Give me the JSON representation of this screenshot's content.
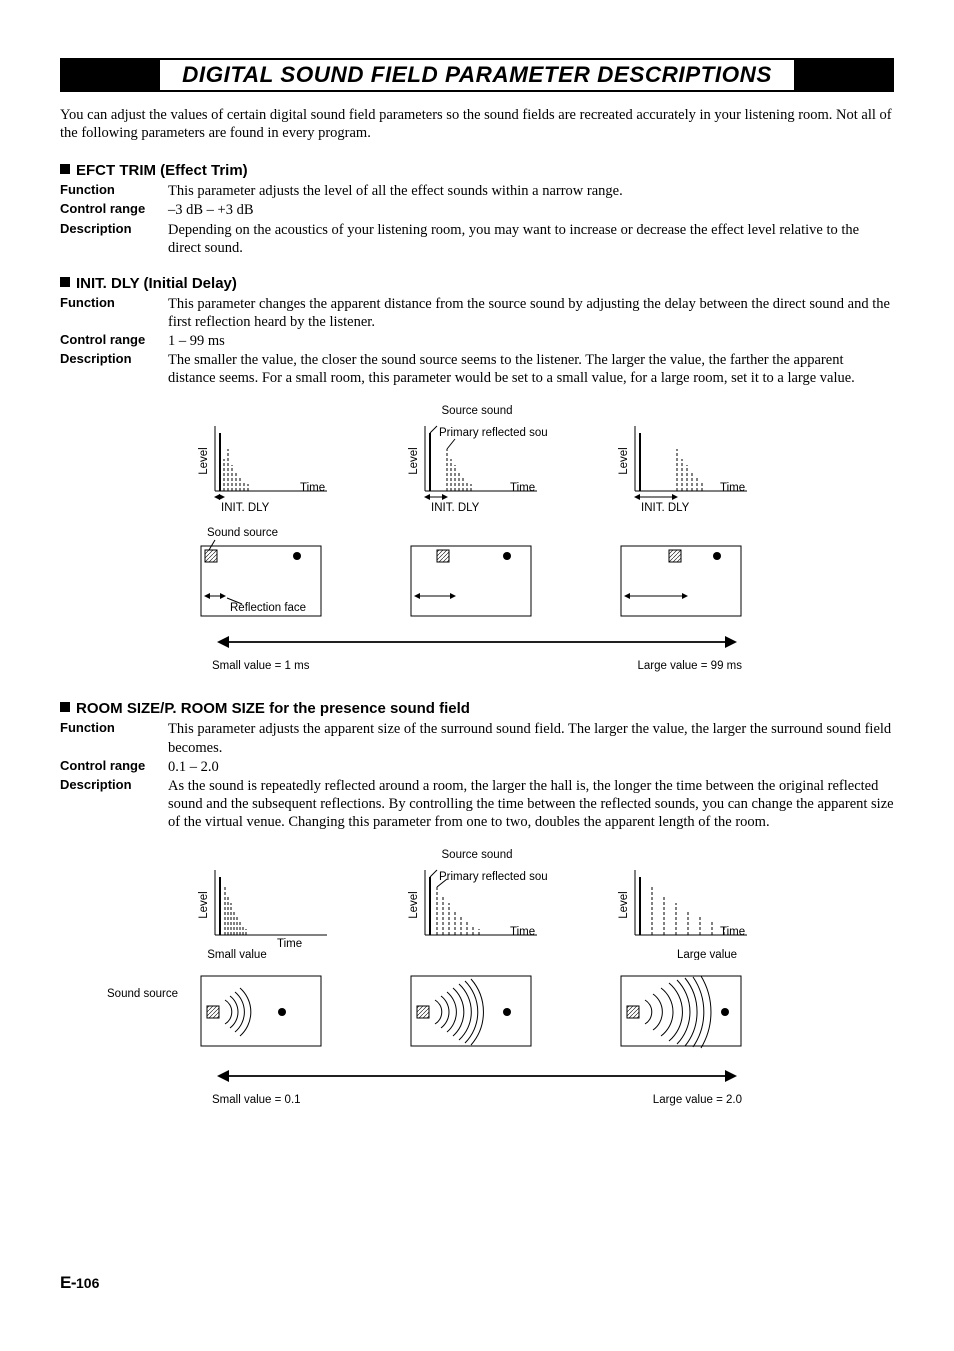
{
  "title": "DIGITAL SOUND FIELD PARAMETER DESCRIPTIONS",
  "intro": "You can adjust the values of certain digital sound field parameters so the sound fields are recreated accurately in your listening room. Not all of the following parameters are found in every program.",
  "labels": {
    "function": "Function",
    "control_range": "Control range",
    "description": "Description"
  },
  "sec1": {
    "heading": "EFCT TRIM (Effect Trim)",
    "function": "This parameter adjusts the level of all the effect sounds within a narrow range.",
    "range": "–3 dB – +3 dB",
    "description": "Depending on the acoustics of your listening room, you may want to increase or decrease the effect level relative to the direct sound."
  },
  "sec2": {
    "heading": "INIT. DLY (Initial Delay)",
    "function": "This parameter changes the apparent distance from the source sound by adjusting the delay between the direct sound and the first reflection heard by the listener.",
    "range": "1 – 99 ms",
    "description": "The smaller the value, the closer the sound source seems to the listener. The larger the value, the farther the apparent distance seems. For a small room, this parameter would be set to a small value, for a large room, set it to a large value."
  },
  "diag1": {
    "source_sound": "Source sound",
    "primary_reflected": "Primary reflected sound",
    "level": "Level",
    "time": "Time",
    "init_dly": "INIT. DLY",
    "sound_source": "Sound source",
    "reflection_face": "Reflection face",
    "small_value": "Small value = 1 ms",
    "large_value": "Large value = 99 ms"
  },
  "sec3": {
    "heading": "ROOM SIZE/P. ROOM SIZE for the presence sound field",
    "function": "This parameter adjusts the apparent size of the surround sound field. The larger the value, the larger the surround sound field becomes.",
    "range": "0.1 – 2.0",
    "description": "As the sound is repeatedly reflected around a room, the larger the hall is, the longer the time between the original reflected sound and the subsequent reflections. By controlling the time between the reflected sounds, you can change the apparent size of the virtual venue. Changing this parameter from one to two, doubles the apparent length of the room."
  },
  "diag2": {
    "source_sound": "Source sound",
    "primary_reflected": "Primary reflected sound",
    "level": "Level",
    "time": "Time",
    "sound_source": "Sound source",
    "small_value_label": "Small value",
    "large_value_label": "Large value",
    "small_value": "Small value = 0.1",
    "large_value": "Large value = 2.0"
  },
  "page": "106"
}
